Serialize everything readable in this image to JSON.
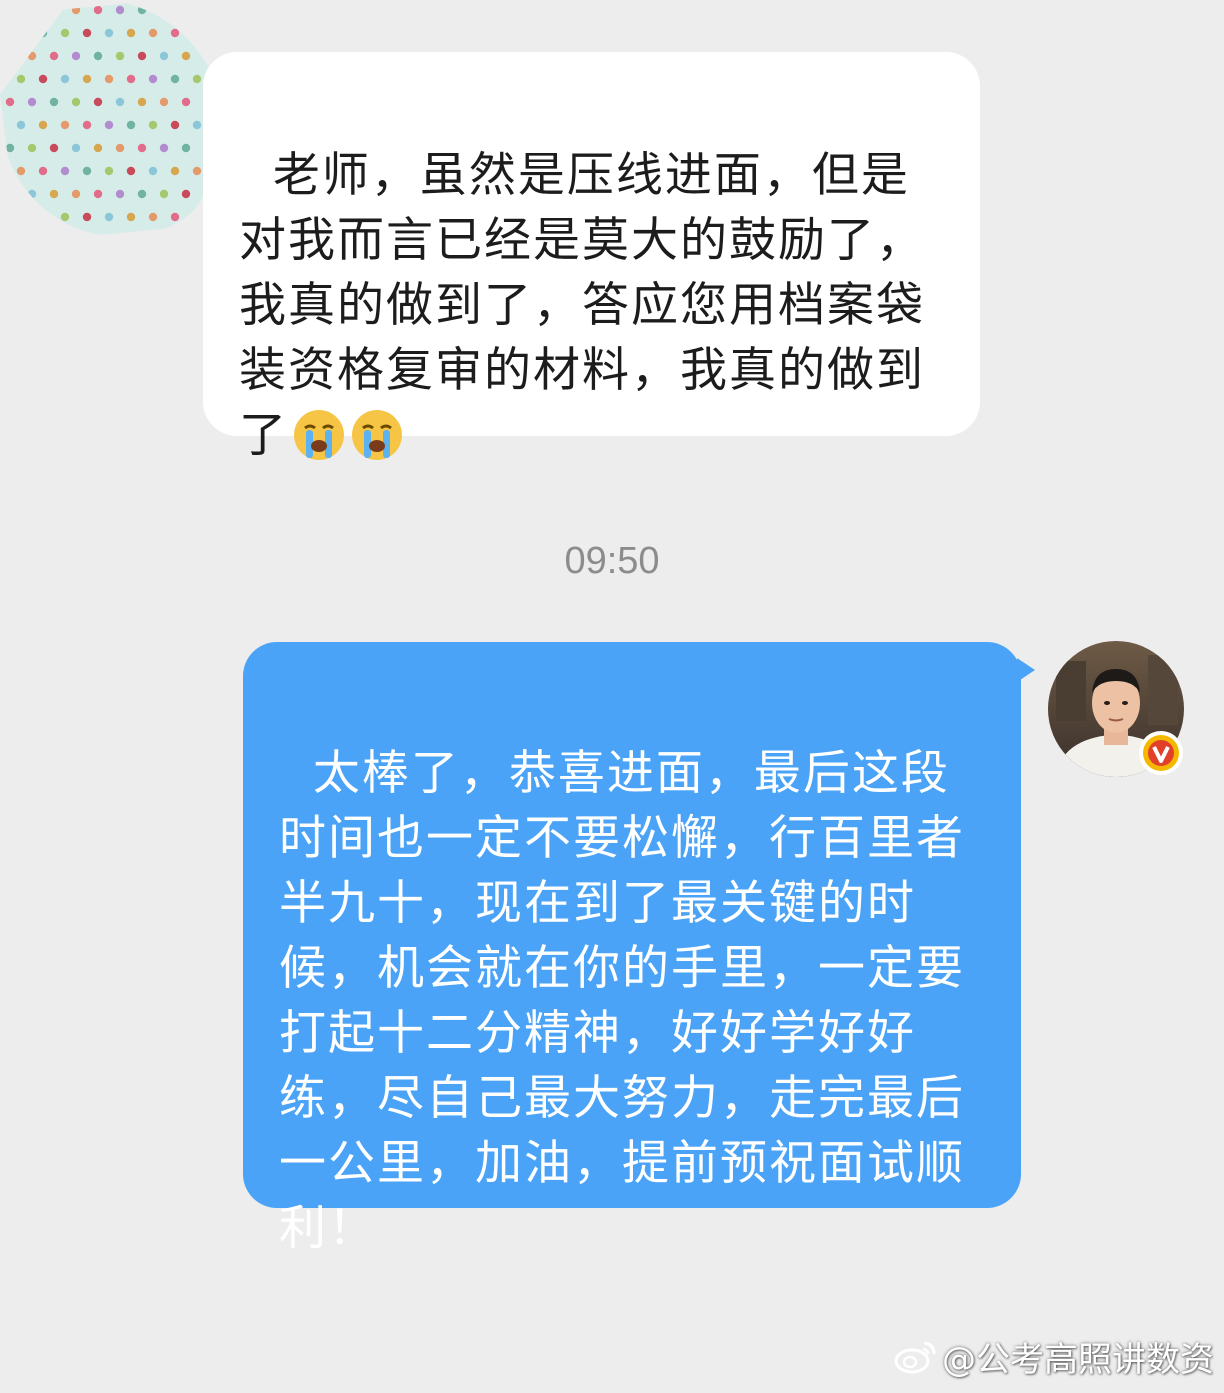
{
  "conversation": {
    "incoming": {
      "text": "老师，虽然是压线进面，但是对我而言已经是莫大的鼓励了，我真的做到了，答应您用档案袋装资格复审的材料，我真的做到了",
      "emoji": [
        "crying-face-icon",
        "crying-face-icon"
      ]
    },
    "timestamp": "09:50",
    "outgoing": {
      "text": "太棒了，恭喜进面，最后这段时间也一定不要松懈，行百里者半九十，现在到了最关键的时候，机会就在你的手里，一定要打起十二分精神，好好学好好练，尽自己最大努力，走完最后一公里，加油，提前预祝面试顺利！"
    }
  },
  "watermark": {
    "text": "@公考高照讲数资",
    "icon": "weibo-icon"
  },
  "colors": {
    "background": "#EDEDED",
    "incoming_bubble": "#FFFFFF",
    "outgoing_bubble": "#4AA3F7",
    "timestamp": "#8C8C8C",
    "verified_badge": "#F5B800"
  }
}
